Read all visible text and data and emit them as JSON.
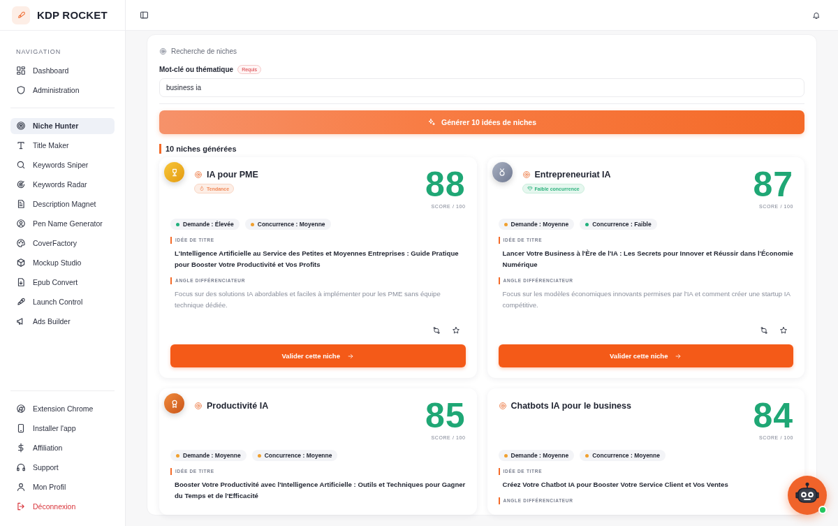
{
  "app": {
    "name": "KDP ROCKET"
  },
  "sidebar": {
    "section_label": "NAVIGATION",
    "groups": [
      [
        {
          "label": "Dashboard",
          "selected": false,
          "kind": "normal"
        },
        {
          "label": "Administration",
          "selected": false,
          "kind": "normal"
        }
      ],
      [
        {
          "label": "Niche Hunter",
          "selected": true,
          "kind": "normal"
        },
        {
          "label": "Title Maker",
          "selected": false,
          "kind": "normal"
        },
        {
          "label": "Keywords Sniper",
          "selected": false,
          "kind": "normal"
        },
        {
          "label": "Keywords Radar",
          "selected": false,
          "kind": "normal"
        },
        {
          "label": "Description Magnet",
          "selected": false,
          "kind": "normal"
        },
        {
          "label": "Pen Name Generator",
          "selected": false,
          "kind": "normal"
        },
        {
          "label": "CoverFactory",
          "selected": false,
          "kind": "normal"
        },
        {
          "label": "Mockup Studio",
          "selected": false,
          "kind": "normal"
        },
        {
          "label": "Epub Convert",
          "selected": false,
          "kind": "normal"
        },
        {
          "label": "Launch Control",
          "selected": false,
          "kind": "normal"
        },
        {
          "label": "Ads Builder",
          "selected": false,
          "kind": "normal"
        }
      ],
      [
        {
          "label": "Extension Chrome",
          "selected": false,
          "kind": "normal"
        },
        {
          "label": "Installer l'app",
          "selected": false,
          "kind": "normal"
        },
        {
          "label": "Affiliation",
          "selected": false,
          "kind": "normal"
        },
        {
          "label": "Support",
          "selected": false,
          "kind": "normal"
        },
        {
          "label": "Mon Profil",
          "selected": false,
          "kind": "normal"
        },
        {
          "label": "Déconnexion",
          "selected": false,
          "kind": "danger"
        }
      ]
    ]
  },
  "search": {
    "title": "Recherche de niches",
    "field_label": "Mot-clé ou thématique",
    "required_badge": "Requis",
    "value": "business ia",
    "generate_button": "Générer 10 idées de niches"
  },
  "results": {
    "heading": "10 niches générées",
    "cards": [
      {
        "kind": "gold",
        "name": "IA pour PME",
        "badge": {
          "kind": "trend",
          "label": "Tendance"
        },
        "score": "88",
        "score_label": "SCORE / 100",
        "demand": {
          "label": "Demande : Élevée",
          "color": "#22b07d"
        },
        "competition": {
          "label": "Concurrence : Moyenne",
          "color": "#f0a030"
        },
        "title_label": "IDÉE DE TITRE",
        "title_idea": "L'Intelligence Artificielle au Service des Petites et Moyennes Entreprises : Guide Pratique pour Booster Votre Productivité et Vos Profits",
        "angle_label": "ANGLE DIFFÉRENCIATEUR",
        "angle": "Focus sur des solutions IA abordables et faciles à implémenter pour les PME sans équipe technique dédiée.",
        "button": "Valider cette niche"
      },
      {
        "kind": "silver",
        "name": "Entrepreneuriat IA",
        "badge": {
          "kind": "low_competition",
          "label": "Faible concurrence"
        },
        "score": "87",
        "score_label": "SCORE / 100",
        "demand": {
          "label": "Demande : Moyenne",
          "color": "#f0a030"
        },
        "competition": {
          "label": "Concurrence : Faible",
          "color": "#22b07d"
        },
        "title_label": "IDÉE DE TITRE",
        "title_idea": "Lancer Votre Business à l'Ère de l'IA : Les Secrets pour Innover et Réussir dans l'Économie Numérique",
        "angle_label": "ANGLE DIFFÉRENCIATEUR",
        "angle": "Focus sur les modèles économiques innovants permises par l'IA et comment créer une startup IA compétitive.",
        "button": "Valider cette niche"
      },
      {
        "kind": "bronze",
        "name": "Productivité IA",
        "score": "85",
        "score_label": "SCORE / 100",
        "demand": {
          "label": "Demande : Moyenne",
          "color": "#f0a030"
        },
        "competition": {
          "label": "Concurrence : Moyenne",
          "color": "#f0a030"
        },
        "title_label": "IDÉE DE TITRE",
        "title_idea": "Booster Votre Productivité avec l'Intelligence Artificielle : Outils et Techniques pour Gagner du Temps et de l'Efficacité"
      },
      {
        "kind": "plain",
        "name": "Chatbots IA pour le business",
        "score": "84",
        "score_label": "SCORE / 100",
        "demand": {
          "label": "Demande : Moyenne",
          "color": "#f0a030"
        },
        "competition": {
          "label": "Concurrence : Moyenne",
          "color": "#f0a030"
        },
        "title_label": "IDÉE DE TITRE",
        "title_idea": "Créez Votre Chatbot IA pour Booster Votre Service Client et Vos Ventes",
        "angle_label": "ANGLE DIFFÉRENCIATEUR"
      }
    ]
  },
  "assistant": {
    "online": true
  }
}
